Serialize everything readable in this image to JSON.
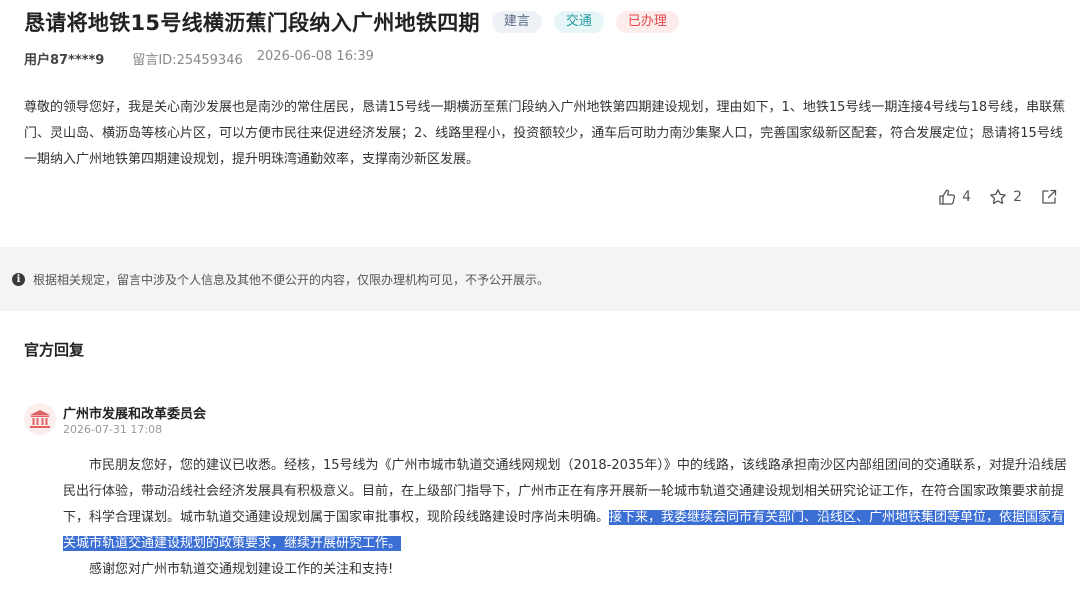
{
  "post": {
    "title": "恳请将地铁15号线横沥蕉门段纳入广州地铁四期",
    "tags": [
      "建言",
      "交通",
      "已办理"
    ],
    "user": "用户87****9",
    "message_id": "留言ID:25459346",
    "datetime": "2026-06-08 16:39",
    "body": "尊敬的领导您好，我是关心南沙发展也是南沙的常住居民，恳请15号线一期横沥至蕉门段纳入广州地铁第四期建设规划，理由如下，1、地铁15号线一期连接4号线与18号线，串联蕉门、灵山岛、横沥岛等核心片区，可以方便市民往来促进经济发展；2、线路里程小，投资额较少，通车后可助力南沙集聚人口，完善国家级新区配套，符合发展定位；恳请将15号线一期纳入广州地铁第四期建设规划，提升明珠湾通勤效率，支撑南沙新区发展。",
    "like_count": "4",
    "favorite_count": "2"
  },
  "notice": "根据相关规定，留言中涉及个人信息及其他不便公开的内容，仅限办理机构可见，不予公开展示。",
  "reply_section": {
    "heading": "官方回复",
    "org_name": "广州市发展和改革委员会",
    "date": "2026-07-31 17:08",
    "paragraph1_plain": "市民朋友您好，您的建议已收悉。经核，15号线为《广州市城市轨道交通线网规划（2018-2035年）》中的线路，该线路承担南沙区内部组团间的交通联系，对提升沿线居民出行体验，带动沿线社会经济发展具有积极意义。目前，在上级部门指导下，广州市正在有序开展新一轮城市轨道交通建设规划相关研究论证工作，在符合国家政策要求前提下，科学合理谋划。城市轨道交通建设规划属于国家审批事权，现阶段线路建设时序尚未明确。",
    "paragraph1_highlight": "接下来，我委继续会同市有关部门、沿线区、广州地铁集团等单位，依据国家有关城市轨道交通建设规划的政策要求，继续开展研究工作。",
    "paragraph2": "感谢您对广州市轨道交通规划建设工作的关注和支持!"
  },
  "colors": {
    "highlight_bg": "#3b6fd4",
    "tag_red": "#e04a4a",
    "tag_teal": "#2a9aa2"
  },
  "icons": [
    "thumbs-up-icon",
    "star-icon",
    "share-icon",
    "info-icon",
    "government-building-icon"
  ]
}
